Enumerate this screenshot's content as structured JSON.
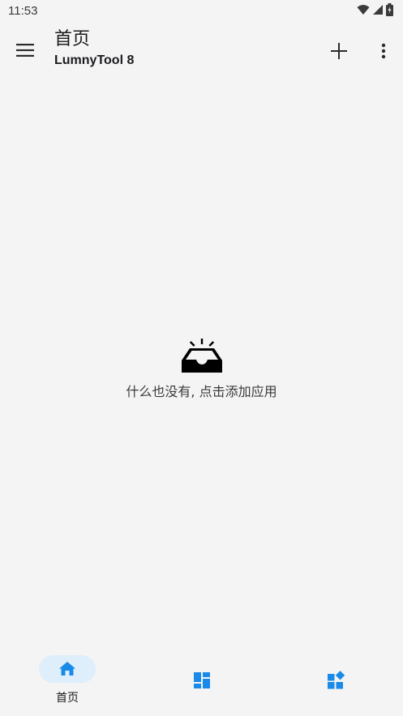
{
  "status_bar": {
    "time": "11:53"
  },
  "app_bar": {
    "title": "首页",
    "subtitle": "LumnyTool 8"
  },
  "empty_state": {
    "message": "什么也没有, 点击添加应用"
  },
  "bottom_nav": {
    "items": [
      {
        "label": "首页",
        "icon": "home-icon",
        "selected": true
      },
      {
        "label": "",
        "icon": "dashboard-icon",
        "selected": false
      },
      {
        "label": "",
        "icon": "widgets-icon",
        "selected": false
      }
    ]
  },
  "colors": {
    "background": "#f4f4f4",
    "accent": "#1a8ae8",
    "indicator": "#deeefb",
    "text": "#1b1b1f"
  }
}
